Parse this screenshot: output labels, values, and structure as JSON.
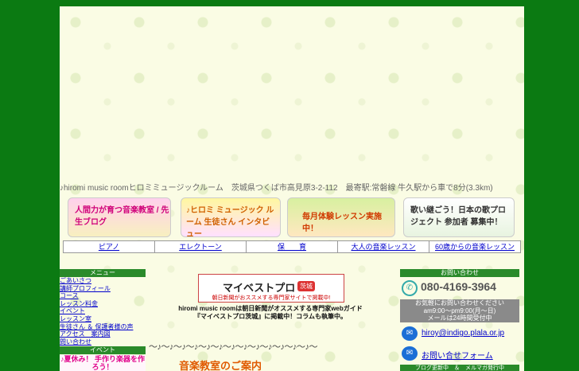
{
  "header": {
    "address": "♪hiromi music roomヒロミミュージックルーム　茨城県つくば市高見原3-2-112　最寄駅:常磐線 牛久駅から車で8分(3.3km)"
  },
  "banners": [
    {
      "label": "人間力が育つ音楽教室 / 先生ブログ"
    },
    {
      "label": "♪ヒロミ ミュージック ルーム 生徒さん インタビュー"
    },
    {
      "label": "毎月体験レッスン実施中！"
    },
    {
      "label": "歌い継ごう！日本の歌プロジェクト 参加者 募集中！"
    }
  ],
  "nav": [
    "ピアノ",
    "エレクトーン",
    "保　　育",
    "大人の音楽レッスン",
    "60歳からの音楽レッスン"
  ],
  "left": {
    "menu_title": "メニュー",
    "items": [
      "ごあいさつ",
      "講師プロフィール",
      "コース",
      "レッスン料金",
      "イベント",
      "レッスン室",
      "生徒さん ＆ 保護者様の声",
      "アクセス　案内図",
      "問い合わせ"
    ],
    "event_title": "イベント",
    "event_text": "♪夏休み！ 手作り楽器を作ろう！"
  },
  "center": {
    "logo_main": "マイベストプロ",
    "logo_tag": "茨城",
    "logo_sub": "朝日新聞がおススメする専門家サイトで掲載中!",
    "promo_line1": "hiromi music roomは朝日新聞がオススメする専門家webガイド",
    "promo_line2": "『マイベストプロ茨城』に掲載中！コラムも執筆中。",
    "notes": "～♪～♪～♪～♪～♪～♪～♪～♪～♪～♪～♪～♪～♪～",
    "section_title": "音楽教室のご案内"
  },
  "right": {
    "contact_title": "お問い合わせ",
    "phone": "080-4169-3964",
    "hours1": "お気軽にお問い合わせください",
    "hours2": "am9:00～pm9:00(月～日)",
    "hours3": "メールは24時間受付中",
    "email": "hiroy@indigo.plala.or.jp",
    "form_label": "お問い合せフォーム",
    "blog_bar": "ブログ更新中　＆　メルマガ発行中"
  }
}
